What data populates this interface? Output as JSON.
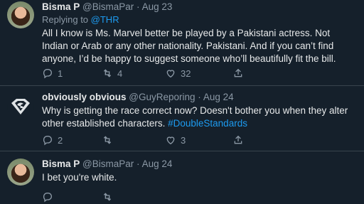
{
  "tweets": [
    {
      "name": "Bisma P",
      "handle": "@BismaPar",
      "sep": "·",
      "date": "Aug 23",
      "replying_prefix": "Replying to",
      "replying_to": "@THR",
      "text": "All I know is Ms. Marvel better be played by a Pakistani actress. Not Indian or Arab or any other nationality. Pakistani. And if you can’t find anyone, I’d be happy to suggest someone who’ll beautifully fit the bill.",
      "replies": "1",
      "retweets": "4",
      "likes": "32"
    },
    {
      "name": "obviously obvious",
      "handle": "@GuyReporing",
      "sep": "·",
      "date": "Aug 24",
      "text": "Why is getting the race correct now? Doesn't bother you when they alter other established characters.",
      "hashtag": "#DoubleStandards",
      "replies": "2",
      "retweets": "",
      "likes": "3"
    },
    {
      "name": "Bisma P",
      "handle": "@BismaPar",
      "sep": "·",
      "date": "Aug 24",
      "text": "I bet you're white."
    }
  ],
  "icons": {
    "reply": "reply-icon",
    "retweet": "retweet-icon",
    "like": "heart-icon",
    "share": "share-icon"
  }
}
